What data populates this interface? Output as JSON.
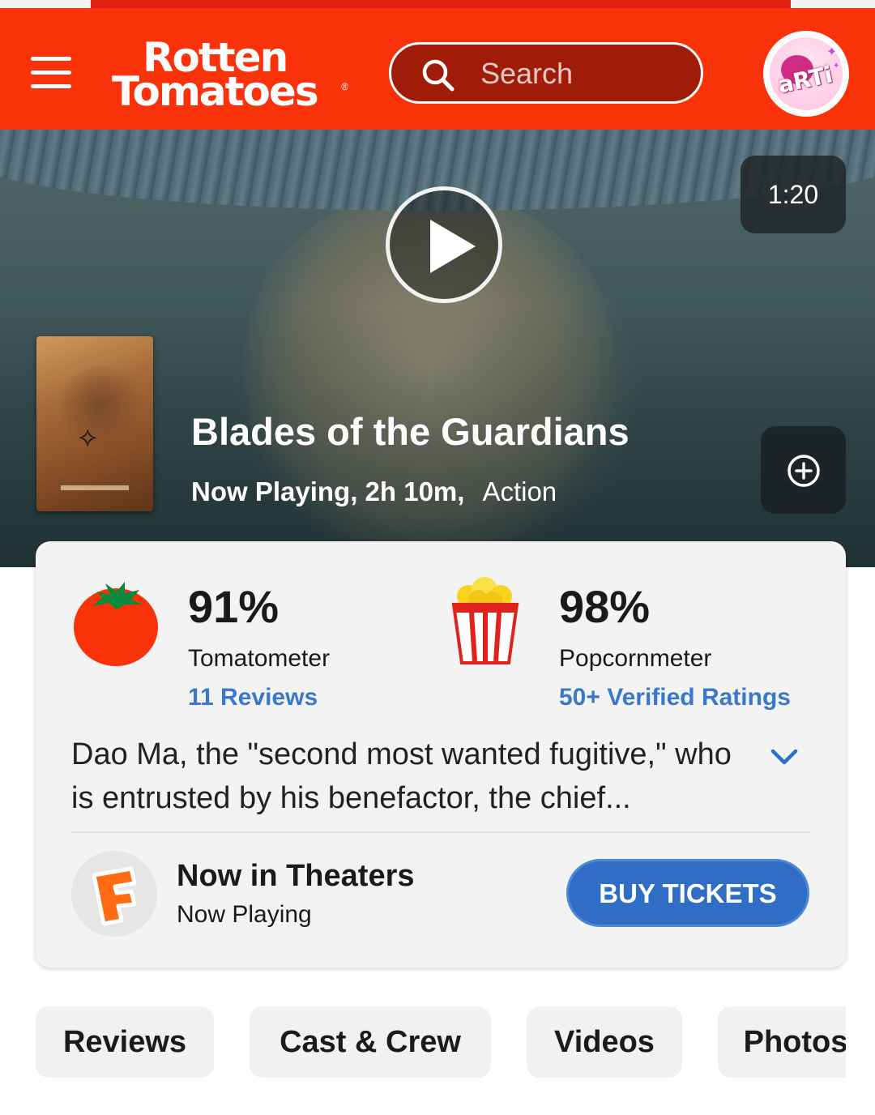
{
  "header": {
    "logo_line1": "Rotten",
    "logo_line2": "Tomatoes",
    "logo_reg": "®",
    "search_placeholder": "Search",
    "avatar_text": "aRTi"
  },
  "hero": {
    "duration": "1:20",
    "title": "Blades of the Guardians",
    "status": "Now Playing, 2h 10m,",
    "genre": "Action"
  },
  "scores": {
    "tomatometer": {
      "value": "91%",
      "label": "Tomatometer",
      "link": "11 Reviews"
    },
    "popcornmeter": {
      "value": "98%",
      "label": "Popcornmeter",
      "link": "50+ Verified Ratings"
    }
  },
  "synopsis": {
    "text": "Dao Ma, the \"second most wanted fugitive,\" who is entrusted by his benefactor, the chief..."
  },
  "theaters": {
    "title": "Now in Theaters",
    "subtitle": "Now Playing",
    "button": "BUY TICKETS"
  },
  "tabs": [
    "Reviews",
    "Cast & Crew",
    "Videos",
    "Photos"
  ],
  "colors": {
    "header_red": "#fa320a",
    "link_blue": "#3a78cc",
    "button_blue": "#2f6ec4"
  }
}
